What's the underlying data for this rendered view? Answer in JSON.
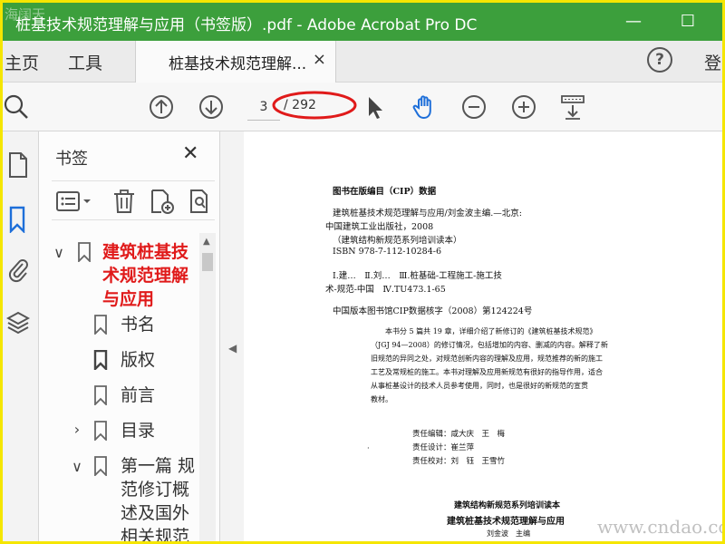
{
  "window": {
    "title": "桩基技术规范理解与应用（书签版）.pdf - Adobe Acrobat Pro DC",
    "watermark": "海阔天",
    "minimize": "—",
    "maximize": "☐"
  },
  "tabs": {
    "home": "主页",
    "tools": "工具",
    "document": "桩基技术规范理解...",
    "close": "×",
    "login": "登"
  },
  "toolbar": {
    "page_current": "3",
    "page_total": "/ 292",
    "annotation_color": "#e01a1a"
  },
  "bookmarks": {
    "title": "书签",
    "close": "✕",
    "items": [
      {
        "label": "建筑桩基技术规范理解与应用",
        "lines": [
          "建筑桩基技",
          "术规范理解",
          "与应用"
        ],
        "expanded": true,
        "highlight": true
      },
      {
        "label": "书名"
      },
      {
        "label": "版权"
      },
      {
        "label": "前言"
      },
      {
        "label": "目录",
        "collapsed": true
      },
      {
        "label": "第一篇 规范修订概述及国外相关规范",
        "lines": [
          "第一篇 规",
          "范修订概",
          "述及国外",
          "相关规范"
        ],
        "expanded": true
      }
    ]
  },
  "document_page": {
    "cip_heading": "图书在版编目（CIP）数据",
    "cip_lines": [
      "建筑桩基技术规范理解与应用/刘金波主编.—北京:",
      "中国建筑工业出版社，2008",
      "（建筑结构新规范系列培训读本）",
      "ISBN 978-7-112-10284-6"
    ],
    "class_lines": [
      "Ⅰ.建…　Ⅱ.刘…　Ⅲ.桩基础-工程施工-施工技",
      "术-规范-中国　Ⅳ.TU473.1-65"
    ],
    "cip_number": "中国版本图书馆CIP数据核字（2008）第124224号",
    "abstract": [
      "本书分 5 篇共 19 章，详细介绍了新修订的《建筑桩基技术规范》",
      "（JGJ 94—2008）的修订情况，包括增加的内容、删减的内容。解释了新",
      "旧规范的异同之处，对规范创新内容的理解及应用，规范推荐的新的施工",
      "工艺及常规桩的施工。本书对理解及应用新规范有很好的指导作用，适合",
      "从事桩基设计的技术人员参考使用，同时，也是很好的新规范的宣贯",
      "教材。"
    ],
    "credits": [
      "责任编辑：咸大庆　王　梅",
      "责任设计：崔兰萍",
      "责任校对：刘　钰　王雪竹"
    ],
    "series_line": "建筑结构新规范系列培训读本",
    "book_title": "建筑桩基技术规范理解与应用",
    "editor_line": "刘金波　主编",
    "mark": "·"
  },
  "site_watermark": "www.cndao.com"
}
